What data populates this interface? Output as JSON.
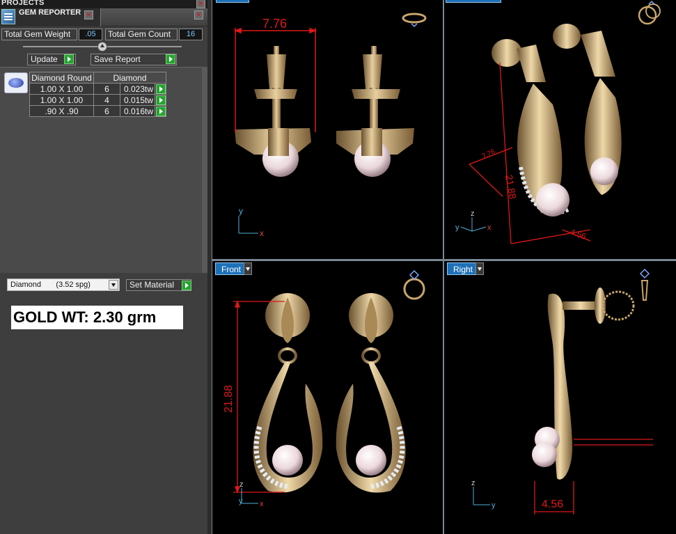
{
  "left_panel": {
    "projects_title": "PROJECTS",
    "gem_reporter_title": "GEM REPORTER",
    "total_gem_weight_label": "Total Gem Weight",
    "total_gem_weight_value": ".05",
    "total_gem_count_label": "Total Gem Count",
    "total_gem_count_value": "16",
    "update_label": "Update",
    "save_report_label": "Save Report",
    "table": {
      "headers": [
        "Diamond Round",
        "Diamond"
      ],
      "rows": [
        {
          "size": "1.00 X 1.00",
          "count": "6",
          "weight": "0.023tw"
        },
        {
          "size": "1.00 X 1.00",
          "count": "4",
          "weight": "0.015tw"
        },
        {
          "size": ".90 X .90",
          "count": "6",
          "weight": "0.016tw"
        }
      ]
    },
    "material_select": "Diamond       (3.52 spg)",
    "set_material_label": "Set Material",
    "gold_weight_text": "GOLD WT: 2.30 grm"
  },
  "viewports": {
    "top_left": {
      "dimension": "7.76",
      "axes": [
        "y",
        "x"
      ]
    },
    "top_right": {
      "dimensions": [
        "21.88",
        "7.76",
        "4.56"
      ],
      "axes": [
        "z",
        "y",
        "x"
      ]
    },
    "front": {
      "label": "Front",
      "dimension": "21.88",
      "axes": [
        "z",
        "y",
        "x"
      ]
    },
    "right": {
      "label": "Right",
      "dimension": "4.56",
      "axes": [
        "z",
        "y"
      ]
    }
  },
  "colors": {
    "gold": "#c9a66b",
    "pearl": "#f3e7ea",
    "dimension_red": "#e01818",
    "label_blue": "#1d70b8",
    "go_green": "#26a332"
  }
}
